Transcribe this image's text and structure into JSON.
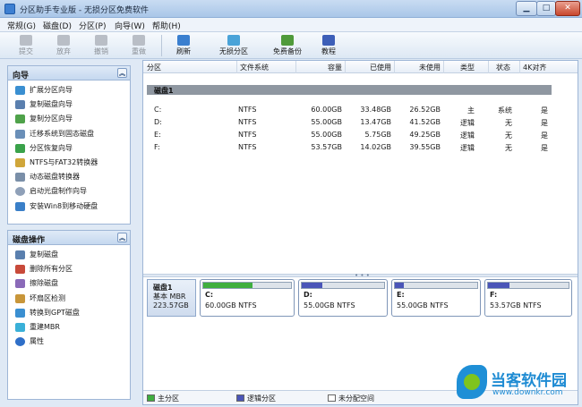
{
  "window": {
    "title": "分区助手专业版 - 无损分区免费软件",
    "min_label": "▁",
    "max_label": "□",
    "close_label": "✕"
  },
  "menu": [
    "常规(G)",
    "磁盘(D)",
    "分区(P)",
    "向导(W)",
    "帮助(H)"
  ],
  "toolbar": {
    "commit": "提交",
    "discard": "放弃",
    "undo": "撤销",
    "redo": "重做",
    "refresh": "刷新",
    "lossless": "无损分区",
    "backup": "免费备份",
    "tutorial": "教程"
  },
  "wizard": {
    "title": "向导",
    "items": [
      "扩展分区向导",
      "复制磁盘向导",
      "复制分区向导",
      "迁移系统到固态磁盘",
      "分区恢复向导",
      "NTFS与FAT32转换器",
      "动态磁盘转换器",
      "启动光盘制作向导",
      "安装Win8到移动硬盘"
    ]
  },
  "disk_ops": {
    "title": "磁盘操作",
    "items": [
      "复制磁盘",
      "删除所有分区",
      "擦除磁盘",
      "坏扇区检测",
      "转换到GPT磁盘",
      "重建MBR",
      "属性"
    ]
  },
  "table": {
    "headers": [
      "分区",
      "文件系统",
      "容量",
      "已使用",
      "未使用",
      "类型",
      "状态",
      "4K对齐"
    ],
    "disk_label": "磁盘1",
    "rows": [
      {
        "part": "C:",
        "fs": "NTFS",
        "cap": "60.00GB",
        "used": "33.48GB",
        "free": "26.52GB",
        "type": "主",
        "status": "系统",
        "align": "是"
      },
      {
        "part": "D:",
        "fs": "NTFS",
        "cap": "55.00GB",
        "used": "13.47GB",
        "free": "41.52GB",
        "type": "逻辑",
        "status": "无",
        "align": "是"
      },
      {
        "part": "E:",
        "fs": "NTFS",
        "cap": "55.00GB",
        "used": "5.75GB",
        "free": "49.25GB",
        "type": "逻辑",
        "status": "无",
        "align": "是"
      },
      {
        "part": "F:",
        "fs": "NTFS",
        "cap": "53.57GB",
        "used": "14.02GB",
        "free": "39.55GB",
        "type": "逻辑",
        "status": "无",
        "align": "是"
      }
    ]
  },
  "diskmap": {
    "name": "磁盘1",
    "kind": "基本 MBR",
    "size": "223.57GB",
    "parts": [
      {
        "letter": "C:",
        "desc": "60.00GB NTFS",
        "used_fraction": 0.558,
        "color": "#3fae3f"
      },
      {
        "letter": "D:",
        "desc": "55.00GB NTFS",
        "used_fraction": 0.245,
        "color": "#4a55b8"
      },
      {
        "letter": "E:",
        "desc": "55.00GB NTFS",
        "used_fraction": 0.105,
        "color": "#4a55b8"
      },
      {
        "letter": "F:",
        "desc": "53.57GB NTFS",
        "used_fraction": 0.262,
        "color": "#4a55b8"
      }
    ]
  },
  "legend": {
    "primary": "主分区",
    "logical": "逻辑分区",
    "unallocated": "未分配空间",
    "primary_color": "#3fae3f",
    "logical_color": "#4a55b8",
    "unallocated_color": "#ffffff"
  },
  "watermark": {
    "brand": "当客软件园",
    "url": "www.downkr.com"
  }
}
